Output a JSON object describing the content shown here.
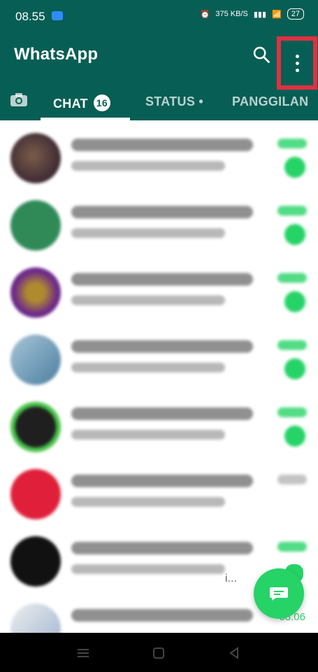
{
  "statusbar": {
    "time": "08.55",
    "net_speed": "375 KB/S",
    "battery": "27"
  },
  "appbar": {
    "title": "WhatsApp"
  },
  "tabs": {
    "chat_label": "CHAT",
    "chat_badge": "16",
    "status_label": "STATUS •",
    "calls_label": "PANGGILAN"
  },
  "list": {
    "visible_time_bottom": "08.06",
    "overlay_text": "i..."
  },
  "colors": {
    "header": "#075e54",
    "accent": "#25d366",
    "highlight": "#e03040"
  },
  "icons": {
    "search": "search-icon",
    "menu": "more-vert-icon",
    "camera": "camera-icon",
    "fab": "chat-icon"
  }
}
